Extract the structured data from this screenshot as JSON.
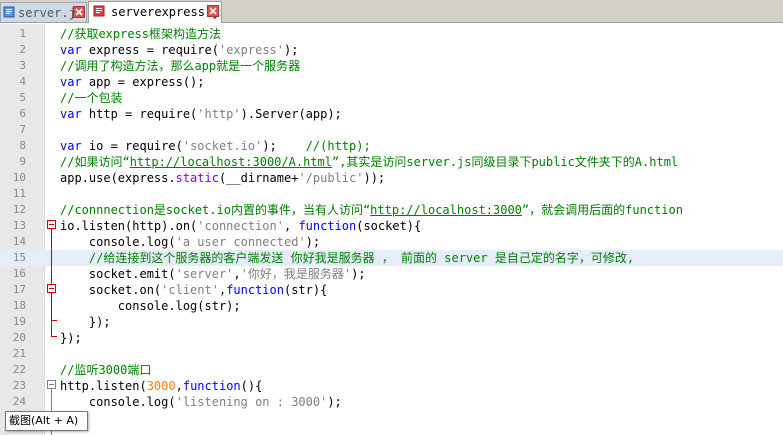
{
  "tabs": [
    {
      "label": "server.js",
      "active": false
    },
    {
      "label": "serverexpress.js",
      "active": true
    }
  ],
  "tooltip": {
    "text": "截图(Alt + A)"
  },
  "lines": [
    {
      "n": "1",
      "tokens": [
        {
          "t": "//获取express框架构造方法",
          "c": "cmt"
        }
      ]
    },
    {
      "n": "2",
      "tokens": [
        {
          "t": "var",
          "c": "kw"
        },
        {
          "t": " express = require(",
          "c": ""
        },
        {
          "t": "'express'",
          "c": "str"
        },
        {
          "t": ");",
          "c": ""
        }
      ]
    },
    {
      "n": "3",
      "tokens": [
        {
          "t": "//调用了构造方法，那么app就是一个服务器",
          "c": "cmt"
        }
      ]
    },
    {
      "n": "4",
      "tokens": [
        {
          "t": "var",
          "c": "kw"
        },
        {
          "t": " app = express();",
          "c": ""
        }
      ]
    },
    {
      "n": "5",
      "tokens": [
        {
          "t": "//一个包装",
          "c": "cmt"
        }
      ]
    },
    {
      "n": "6",
      "tokens": [
        {
          "t": "var",
          "c": "kw"
        },
        {
          "t": " http = require(",
          "c": ""
        },
        {
          "t": "'http'",
          "c": "str"
        },
        {
          "t": ").Server(app);",
          "c": ""
        }
      ]
    },
    {
      "n": "7",
      "tokens": []
    },
    {
      "n": "8",
      "tokens": [
        {
          "t": "var",
          "c": "kw"
        },
        {
          "t": " io = require(",
          "c": ""
        },
        {
          "t": "'socket.io'",
          "c": "str"
        },
        {
          "t": ");    ",
          "c": ""
        },
        {
          "t": "//(http);",
          "c": "cmt"
        }
      ]
    },
    {
      "n": "9",
      "tokens": [
        {
          "t": "//如果访问“",
          "c": "cmt"
        },
        {
          "t": "http://localhost:3000/A.html",
          "c": "lnk"
        },
        {
          "t": "”,其实是访问server.js同级目录下public文件夹下的A.html",
          "c": "cmt"
        }
      ]
    },
    {
      "n": "10",
      "tokens": [
        {
          "t": "app.use(express.",
          "c": ""
        },
        {
          "t": "static",
          "c": "ns"
        },
        {
          "t": "(__dirname+",
          "c": ""
        },
        {
          "t": "'/public'",
          "c": "str"
        },
        {
          "t": "));",
          "c": ""
        }
      ]
    },
    {
      "n": "11",
      "tokens": []
    },
    {
      "n": "12",
      "tokens": [
        {
          "t": "//connnection是socket.io内置的事件，当有人访问“",
          "c": "cmt"
        },
        {
          "t": "http://localhost:3000",
          "c": "lnk"
        },
        {
          "t": "”，就会调用后面的function",
          "c": "cmt"
        }
      ]
    },
    {
      "n": "13",
      "tokens": [
        {
          "t": "io.listen(http).on(",
          "c": ""
        },
        {
          "t": "'connection'",
          "c": "str"
        },
        {
          "t": ", ",
          "c": ""
        },
        {
          "t": "function",
          "c": "kw"
        },
        {
          "t": "(socket){",
          "c": ""
        }
      ]
    },
    {
      "n": "14",
      "tokens": [
        {
          "t": "    console.log(",
          "c": ""
        },
        {
          "t": "'a user connected'",
          "c": "str"
        },
        {
          "t": ");",
          "c": ""
        }
      ]
    },
    {
      "n": "15",
      "tokens": [
        {
          "t": "    //给连接到这个服务器的客户端发送 你好我是服务器 ， 前面的 server 是自己定的名字，可修改,",
          "c": "cmt"
        }
      ],
      "hl": true
    },
    {
      "n": "16",
      "tokens": [
        {
          "t": "    socket.emit(",
          "c": ""
        },
        {
          "t": "'server'",
          "c": "str"
        },
        {
          "t": ",",
          "c": ""
        },
        {
          "t": "'你好，我是服务器'",
          "c": "str"
        },
        {
          "t": ");",
          "c": ""
        }
      ]
    },
    {
      "n": "17",
      "tokens": [
        {
          "t": "    socket.on(",
          "c": ""
        },
        {
          "t": "'client'",
          "c": "str"
        },
        {
          "t": ",",
          "c": ""
        },
        {
          "t": "function",
          "c": "kw"
        },
        {
          "t": "(str){",
          "c": ""
        }
      ]
    },
    {
      "n": "18",
      "tokens": [
        {
          "t": "        console.log(str);",
          "c": ""
        }
      ]
    },
    {
      "n": "19",
      "tokens": [
        {
          "t": "    });",
          "c": ""
        }
      ]
    },
    {
      "n": "20",
      "tokens": [
        {
          "t": "});",
          "c": ""
        }
      ]
    },
    {
      "n": "21",
      "tokens": []
    },
    {
      "n": "22",
      "tokens": [
        {
          "t": "//监听3000端口",
          "c": "cmt"
        }
      ]
    },
    {
      "n": "23",
      "tokens": [
        {
          "t": "http.listen(",
          "c": ""
        },
        {
          "t": "3000",
          "c": "num"
        },
        {
          "t": ",",
          "c": ""
        },
        {
          "t": "function",
          "c": "kw"
        },
        {
          "t": "(){",
          "c": ""
        }
      ]
    },
    {
      "n": "24",
      "tokens": [
        {
          "t": "    console.log(",
          "c": ""
        },
        {
          "t": "'listening on : 3000'",
          "c": "str"
        },
        {
          "t": ");",
          "c": ""
        }
      ]
    }
  ]
}
